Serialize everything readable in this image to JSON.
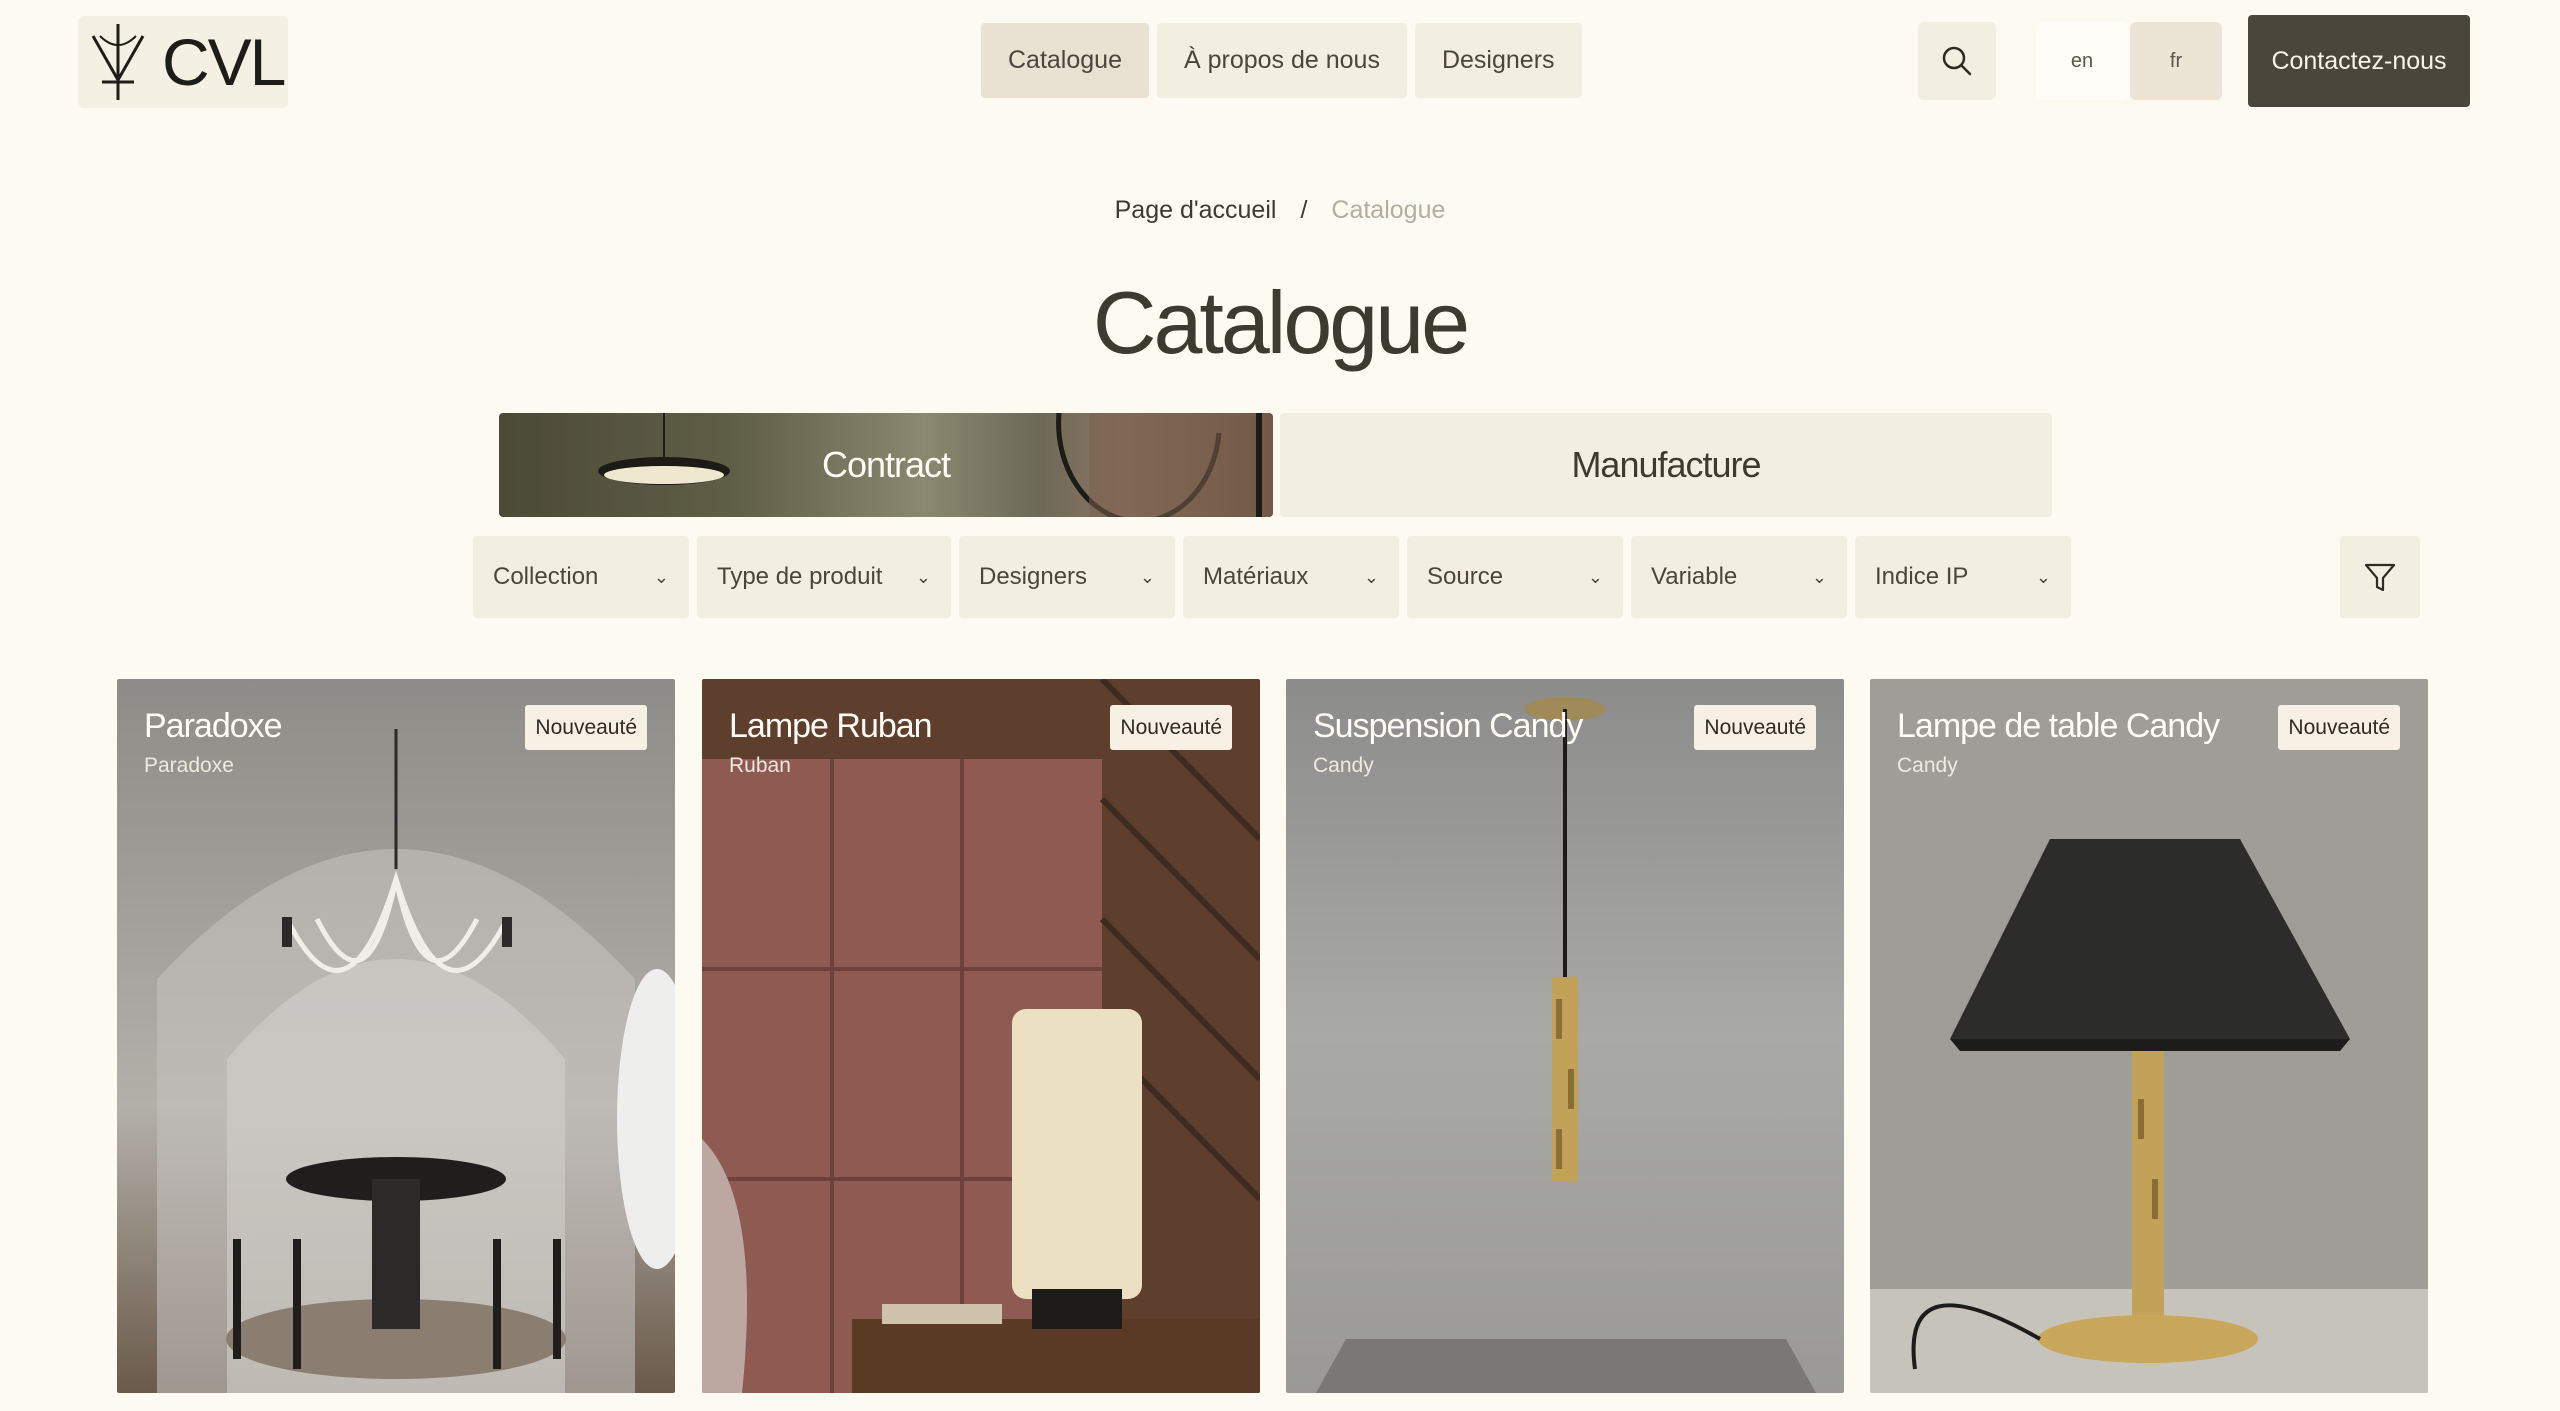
{
  "header": {
    "logo_text": "CVL",
    "nav": [
      {
        "label": "Catalogue",
        "active": true
      },
      {
        "label": "À propos de nous",
        "active": false
      },
      {
        "label": "Designers",
        "active": false
      }
    ],
    "languages": [
      {
        "label": "en",
        "active": false
      },
      {
        "label": "fr",
        "active": true
      }
    ],
    "contact_label": "Contactez-nous"
  },
  "breadcrumb": {
    "home": "Page d'accueil",
    "separator": "/",
    "current": "Catalogue"
  },
  "page_title": "Catalogue",
  "segments": {
    "contract": "Contract",
    "manufacture": "Manufacture",
    "active": "contract"
  },
  "filters": [
    "Collection",
    "Type de produit",
    "Designers",
    "Matériaux",
    "Source",
    "Variable",
    "Indice IP"
  ],
  "products": [
    {
      "title": "Paradoxe",
      "collection": "Paradoxe",
      "badge": "Nouveauté"
    },
    {
      "title": "Lampe Ruban",
      "collection": "Ruban",
      "badge": "Nouveauté"
    },
    {
      "title": "Suspension Candy",
      "collection": "Candy",
      "badge": "Nouveauté"
    },
    {
      "title": "Lampe de table Candy",
      "collection": "Candy",
      "badge": "Nouveauté"
    }
  ],
  "colors": {
    "background": "#fdfaf2",
    "chip": "#f3eee2",
    "chip_active": "#e9e1d1",
    "dark_button": "#4a463c",
    "badge": "#f6f1e4"
  }
}
